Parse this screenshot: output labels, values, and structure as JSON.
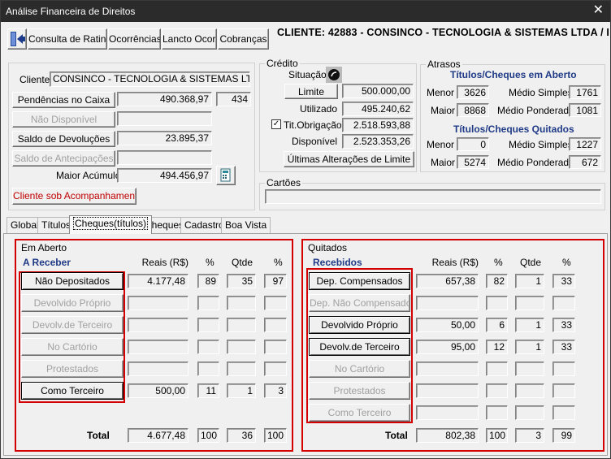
{
  "window": {
    "title": "Análise Financeira de Direitos",
    "close": "✕"
  },
  "toolbar": {
    "exit_icon": "exit-door-icon",
    "b1": "Consulta de Rating",
    "b2": "Ocorrências",
    "b3": "Lancto Ocor.",
    "b4": "Cobranças"
  },
  "header": {
    "client_title": "CLIENTE: 42883 - CONSINCO - TECNOLOGIA & SISTEMAS LTDA  /  I"
  },
  "left": {
    "cliente_label": "Cliente",
    "cliente_value": "CONSINCO - TECNOLOGIA & SISTEMAS LTDA",
    "pend_btn": "Pendências no Caixa",
    "pend_value": "490.368,97",
    "pend_count": "434",
    "nd_btn": "Não Disponível",
    "saldo_dev_btn": "Saldo de Devoluções",
    "saldo_dev_value": "23.895,37",
    "saldo_ant_btn": "Saldo de Antecipações",
    "maior_label": "Maior Acúmulo",
    "maior_value": "494.456,97",
    "acomp_btn": "Cliente sob Acompanhamento",
    "calc_icon": "calculator-icon"
  },
  "credito": {
    "caption": "Crédito",
    "situacao_label": "Situação",
    "limite_btn": "Limite",
    "limite_value": "500.000,00",
    "utilizado_label": "Utilizado",
    "utilizado_value": "495.240,62",
    "tit_label": "Tit.Obrigação",
    "tit_checked": "✓",
    "tit_value": "2.518.593,88",
    "disp_label": "Disponível",
    "disp_value": "2.523.353,26",
    "ult_btn": "Últimas Alterações de Limite"
  },
  "atrasos": {
    "caption": "Atrasos",
    "aberto_title": "Títulos/Cheques em Aberto",
    "quit_title": "Títulos/Cheques Quitados",
    "menor": "Menor",
    "maior": "Maior",
    "medio_s": "Médio Simples",
    "medio_p": "Médio Ponderado",
    "a_menor": "3626",
    "a_maior": "8868",
    "a_ms": "1761",
    "a_mp": "1081",
    "q_menor": "0",
    "q_maior": "5274",
    "q_ms": "1227",
    "q_mp": "672"
  },
  "cartoes": {
    "caption": "Cartões"
  },
  "tabs": [
    "Global",
    "Títulos",
    "Cheques(títulos)",
    "Cheques",
    "Cadastro",
    "Boa Vista"
  ],
  "aberto": {
    "caption": "Em Aberto",
    "title": "A Receber",
    "h_reais": "Reais (R$)",
    "h_pct": "%",
    "h_qtde": "Qtde",
    "h_pct2": "%",
    "rows": [
      {
        "label": "Não Depositados",
        "reais": "4.177,48",
        "pct": "89",
        "qtde": "35",
        "pct2": "97"
      },
      {
        "label": "Devolvido Próprio",
        "reais": "",
        "pct": "",
        "qtde": "",
        "pct2": ""
      },
      {
        "label": "Devolv.de Terceiro",
        "reais": "",
        "pct": "",
        "qtde": "",
        "pct2": ""
      },
      {
        "label": "No Cartório",
        "reais": "",
        "pct": "",
        "qtde": "",
        "pct2": ""
      },
      {
        "label": "Protestados",
        "reais": "",
        "pct": "",
        "qtde": "",
        "pct2": ""
      },
      {
        "label": "Como Terceiro",
        "reais": "500,00",
        "pct": "11",
        "qtde": "1",
        "pct2": "3"
      }
    ],
    "total_label": "Total",
    "total_reais": "4.677,48",
    "total_pct": "100",
    "total_qtde": "36",
    "total_pct2": "100"
  },
  "quitados": {
    "caption": "Quitados",
    "title": "Recebidos",
    "h_reais": "Reais (R$)",
    "h_pct": "%",
    "h_qtde": "Qtde",
    "h_pct2": "%",
    "rows": [
      {
        "label": "Dep. Compensados",
        "reais": "657,38",
        "pct": "82",
        "qtde": "1",
        "pct2": "33"
      },
      {
        "label": "Dep. Não Compensados",
        "reais": "",
        "pct": "",
        "qtde": "",
        "pct2": ""
      },
      {
        "label": "Devolvido Próprio",
        "reais": "50,00",
        "pct": "6",
        "qtde": "1",
        "pct2": "33"
      },
      {
        "label": "Devolv.de Terceiro",
        "reais": "95,00",
        "pct": "12",
        "qtde": "1",
        "pct2": "33"
      },
      {
        "label": "No Cartório",
        "reais": "",
        "pct": "",
        "qtde": "",
        "pct2": ""
      },
      {
        "label": "Protestados",
        "reais": "",
        "pct": "",
        "qtde": "",
        "pct2": ""
      },
      {
        "label": "Como Terceiro",
        "reais": "",
        "pct": "",
        "qtde": "",
        "pct2": ""
      }
    ],
    "total_label": "Total",
    "total_reais": "802,38",
    "total_pct": "100",
    "total_qtde": "3",
    "total_pct2": "99"
  }
}
